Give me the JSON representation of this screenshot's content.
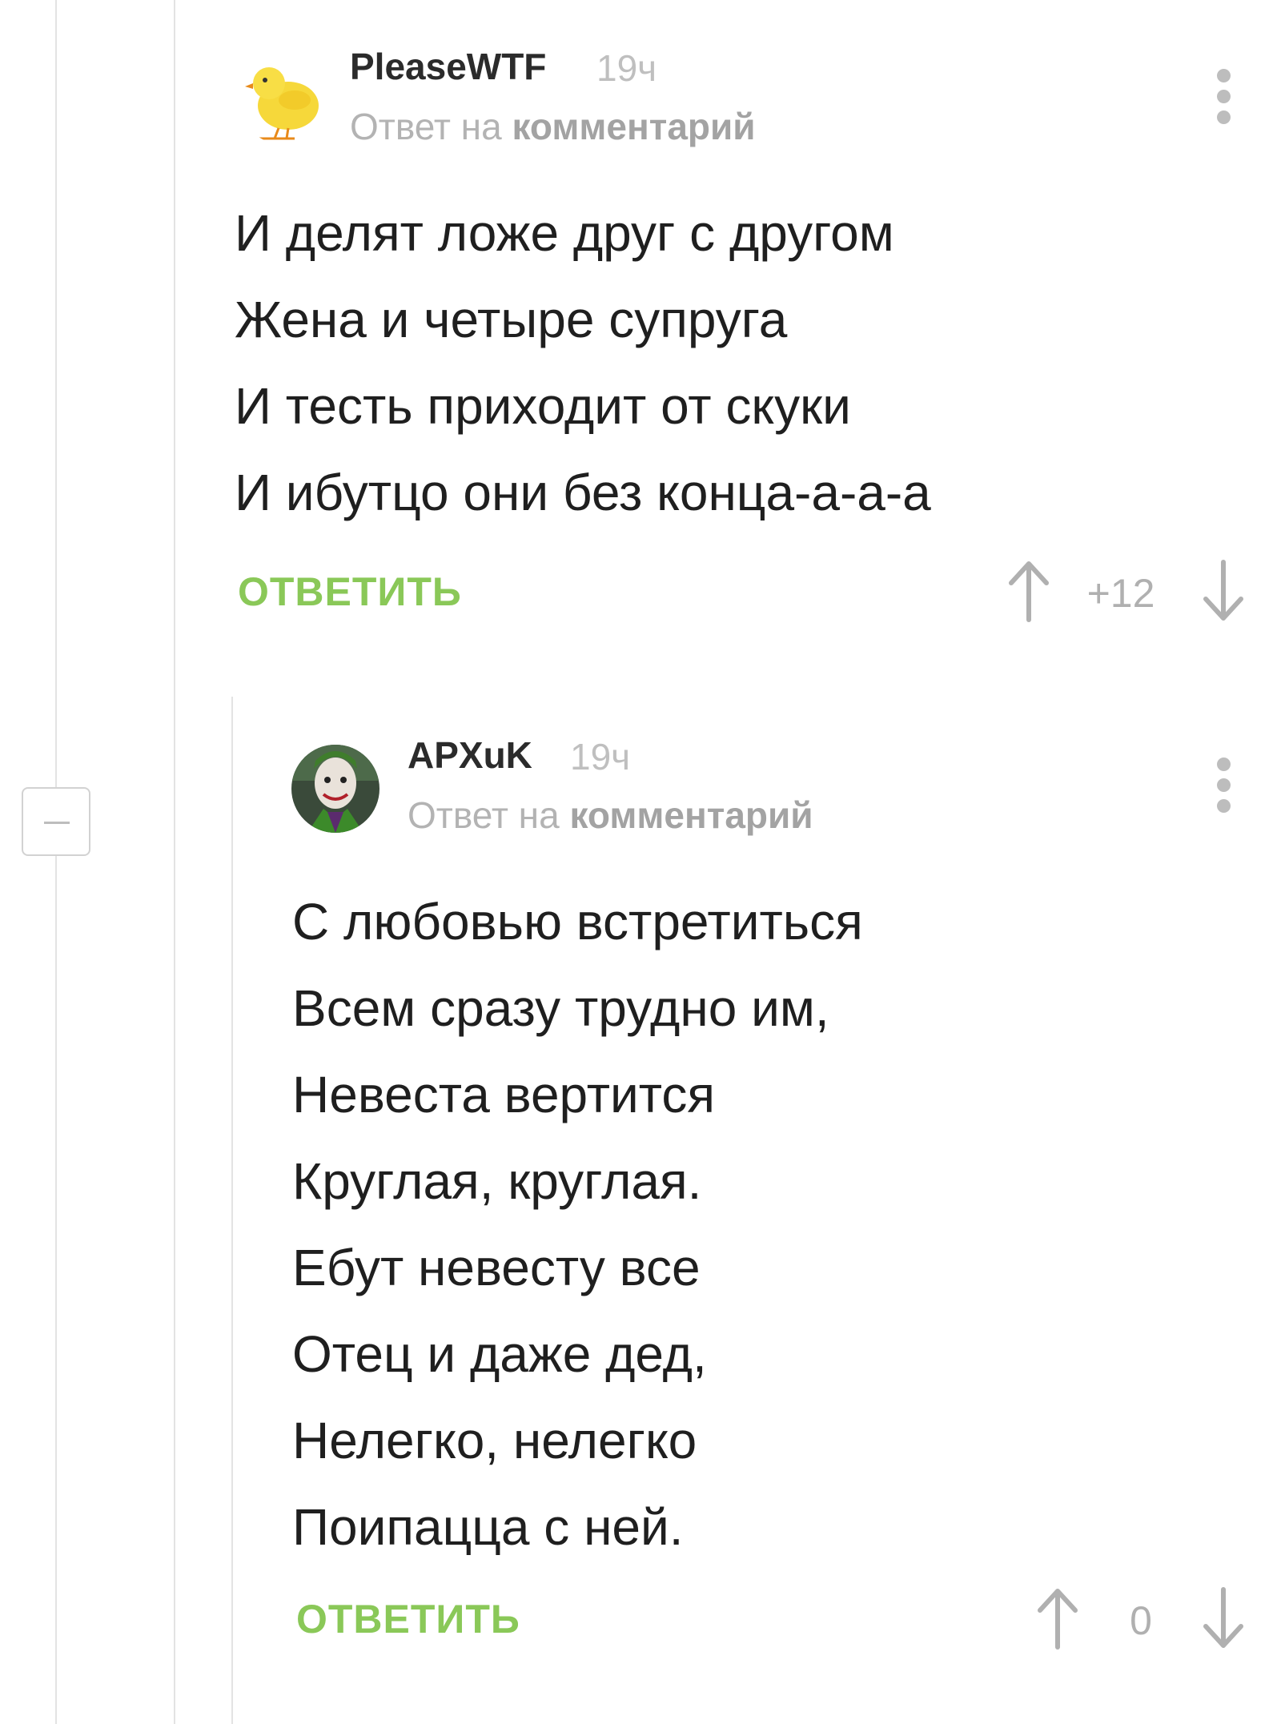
{
  "comments": [
    {
      "author": "PleaseWTF",
      "time": "19ч",
      "reply_prefix": "Ответ на",
      "reply_link": "комментарий",
      "lines": [
        "И делят ложе друг с другом",
        "Жена и четыре супруга",
        "И тесть приходит от скуки",
        "И ибутцо они без конца-а-а-а"
      ],
      "reply_label": "ОТВЕТИТЬ",
      "score": "+12",
      "avatar_icon": "chick-avatar-icon"
    },
    {
      "author": "APXuK",
      "time": "19ч",
      "reply_prefix": "Ответ на",
      "reply_link": "комментарий",
      "lines": [
        "С любовью встретиться",
        "Всем сразу трудно им,",
        "Невеста вертится",
        "Круглая, круглая.",
        "Ебут невесту все",
        "Отец и даже дед,",
        "Нелегко, нелегко",
        "Поипацца с ней."
      ],
      "reply_label": "ОТВЕТИТЬ",
      "score": "0",
      "avatar_icon": "joker-avatar-icon"
    }
  ],
  "colors": {
    "accent": "#8ac858",
    "muted": "#b3b3b3",
    "thread_line": "#e3e3e3"
  }
}
